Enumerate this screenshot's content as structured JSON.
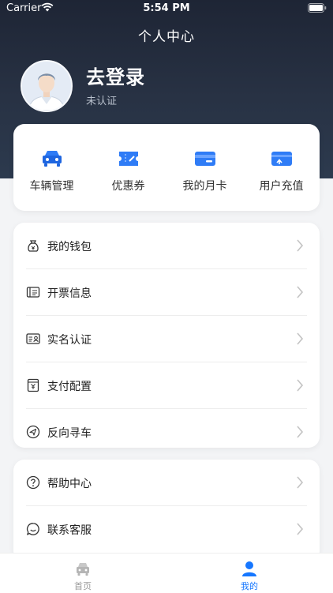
{
  "status_bar": {
    "carrier": "Carrier",
    "time": "5:54 PM"
  },
  "header": {
    "title": "个人中心"
  },
  "profile": {
    "login_label": "去登录",
    "auth_status": "未认证"
  },
  "quick_actions": [
    {
      "label": "车辆管理",
      "icon": "car-icon"
    },
    {
      "label": "优惠券",
      "icon": "coupon-icon"
    },
    {
      "label": "我的月卡",
      "icon": "monthly-card-icon"
    },
    {
      "label": "用户充值",
      "icon": "recharge-icon"
    }
  ],
  "menu_group_1": [
    {
      "label": "我的钱包",
      "icon": "wallet-icon"
    },
    {
      "label": "开票信息",
      "icon": "invoice-icon"
    },
    {
      "label": "实名认证",
      "icon": "id-card-icon"
    },
    {
      "label": "支付配置",
      "icon": "payment-config-icon"
    },
    {
      "label": "反向寻车",
      "icon": "find-car-icon"
    }
  ],
  "menu_group_2": [
    {
      "label": "帮助中心",
      "icon": "help-icon"
    },
    {
      "label": "联系客服",
      "icon": "customer-service-icon"
    }
  ],
  "tab_bar": {
    "tabs": [
      {
        "label": "首页",
        "icon": "home-car-icon",
        "active": false
      },
      {
        "label": "我的",
        "icon": "user-icon",
        "active": true
      }
    ]
  },
  "colors": {
    "header_bg": "#283244",
    "accent": "#1677ff",
    "quick_icon_blue": "#2f7cf6",
    "tab_inactive": "#b5b5b5"
  }
}
